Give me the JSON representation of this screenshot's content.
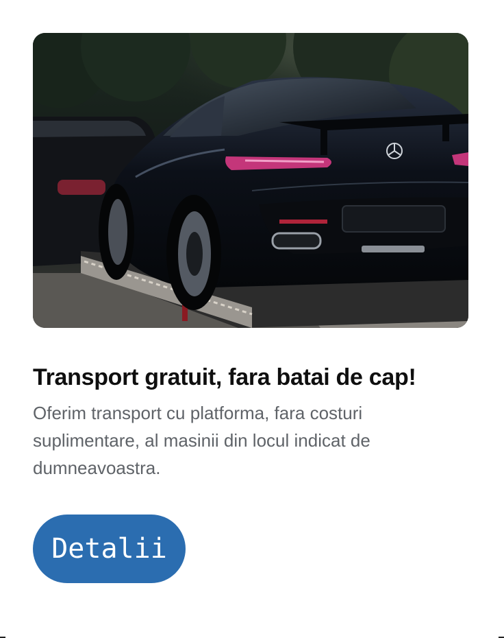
{
  "card": {
    "image_alt": "Black sports car on a tow truck platform",
    "title": "Transport gratuit, fara batai de cap!",
    "description": "Oferim transport cu platforma, fara costuri suplimentare, al masinii din locul indicat de dumneavoastra.",
    "button_label": "Detalii"
  },
  "colors": {
    "button_bg": "#2b6db0",
    "title": "#0f0f0f",
    "description": "#5f6368"
  }
}
